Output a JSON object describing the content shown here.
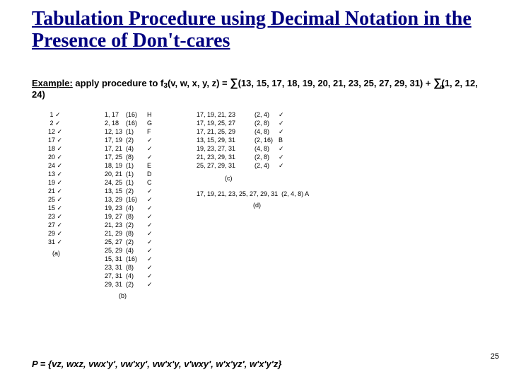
{
  "title": "Tabulation Procedure using Decimal Notation in the Presence of Don't-cares",
  "exampleLead": "Example:",
  "exampleText1": " apply procedure to f",
  "exampleSub": "3",
  "exampleText2": "(v, w, x, y, z) = ",
  "sumList": "(13, 15, 17, 18, 19, 20, 21, 23, 25, 27, 29, 31) + ",
  "sigmaDSub": "Φ",
  "dcList": "(1, 2, 12, 24)",
  "colA": {
    "rows": [
      "1",
      "2",
      "12",
      "17",
      "18",
      "20",
      "24",
      "13",
      "19",
      "21",
      "25",
      "15",
      "23",
      "27",
      "29",
      "31"
    ],
    "caption": "(a)"
  },
  "colB": {
    "pairs": [
      "1, 17",
      "2, 18",
      "12, 13",
      "17, 19",
      "17, 21",
      "17, 25",
      "18, 19",
      "20, 21",
      "24, 25",
      "13, 15",
      "13, 29",
      "19, 23",
      "19, 27",
      "21, 23",
      "21, 29",
      "25, 27",
      "25, 29",
      "15, 31",
      "23, 31",
      "27, 31",
      "29, 31"
    ],
    "diffs": [
      "(16)",
      "(16)",
      "(1)",
      "(2)",
      "(4)",
      "(8)",
      "(1)",
      "(1)",
      "(1)",
      "(2)",
      "(16)",
      "(4)",
      "(8)",
      "(2)",
      "(8)",
      "(2)",
      "(4)",
      "(16)",
      "(8)",
      "(4)",
      "(2)"
    ],
    "tags": [
      "H",
      "G",
      "F",
      "✓",
      "✓",
      "✓",
      "E",
      "D",
      "C",
      "✓",
      "✓",
      "✓",
      "✓",
      "✓",
      "✓",
      "✓",
      "✓",
      "✓",
      "✓",
      "✓",
      "✓"
    ],
    "caption": "(b)"
  },
  "colC": {
    "groups": [
      "17, 19, 21, 23",
      "17, 19, 25, 27",
      "17, 21, 25, 29",
      "13, 15, 29, 31",
      "19, 23, 27, 31",
      "21, 23, 29, 31",
      "25, 27, 29, 31"
    ],
    "diffs": [
      "(2, 4)",
      "(2, 8)",
      "(4, 8)",
      "(2, 16)",
      "(4, 8)",
      "(2, 8)",
      "(2, 4)"
    ],
    "tags": [
      "✓",
      "✓",
      "✓",
      "B",
      "✓",
      "✓",
      "✓"
    ],
    "caption": "(c)"
  },
  "colD": {
    "group": "17, 19, 21, 23, 25, 27, 29, 31",
    "diff": "(2, 4, 8)",
    "tag": "A",
    "caption": "(d)"
  },
  "footer": "P = {vz, wxz, vwx'y', vw'xy', vw'x'y, v'wxy', w'x'yz', w'x'y'z}",
  "pagenum": "25"
}
